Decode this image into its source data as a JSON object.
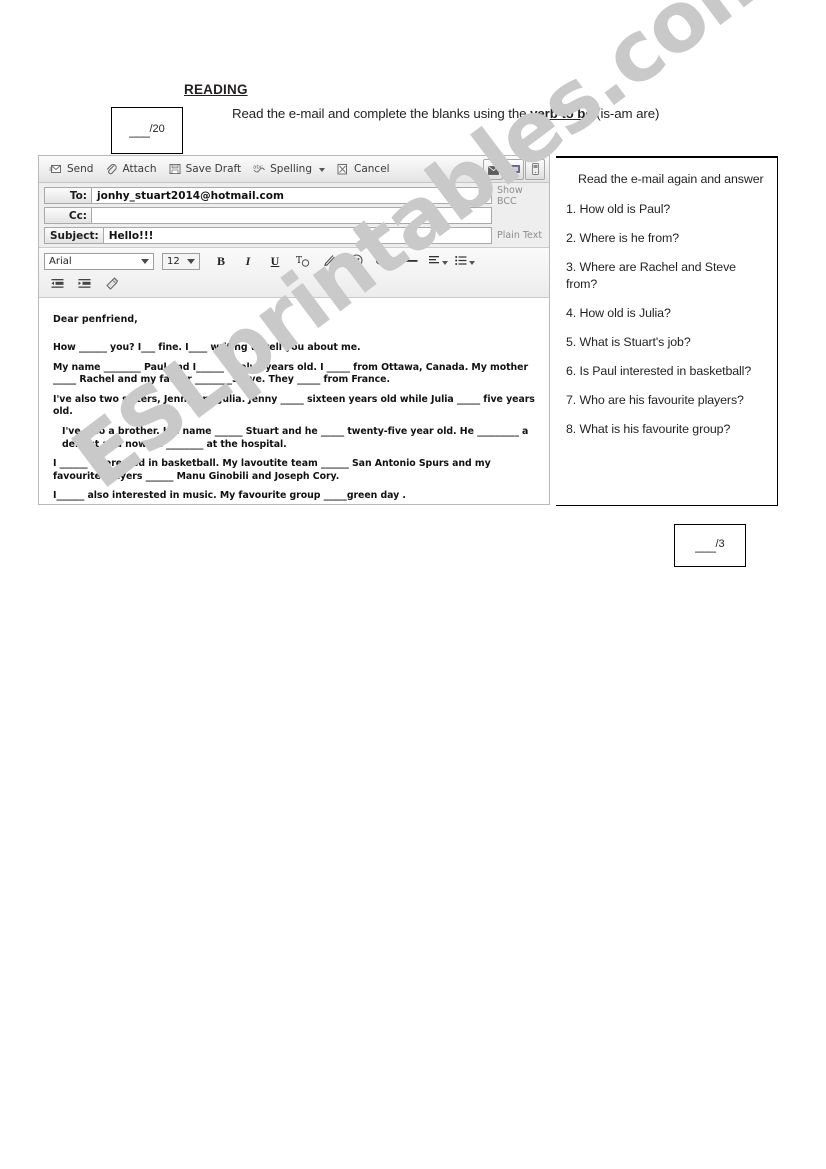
{
  "worksheet": {
    "section_title": "READING",
    "instruction_pre": "Read the e-mail and complete the blanks using the ",
    "instruction_bold": "verb to be",
    "instruction_post": " (is-am are)",
    "score_reading": "___/20",
    "score_reading_blank": "___",
    "score_reading_denom": "/20",
    "score_questions_blank": "___",
    "score_questions_denom": "/3",
    "watermark": "ESLprintables.com"
  },
  "mail": {
    "toolbar": {
      "send_label": "Send",
      "attach_label": "Attach",
      "save_draft_label": "Save Draft",
      "spelling_label": "Spelling",
      "cancel_label": "Cancel",
      "icons": {
        "send": "send-envelope-icon",
        "attach": "paperclip-icon",
        "save_draft": "floppy-disk-icon",
        "spelling": "abc-check-icon",
        "cancel": "cancel-icon",
        "right_1": "envelope-icon",
        "right_2": "message-screen-icon",
        "right_3": "mobile-phone-icon"
      }
    },
    "fields": {
      "to_label": "To:",
      "to_value": "jonhy_stuart2014@hotmail.com",
      "to_aside": "Show BCC",
      "cc_label": "Cc:",
      "cc_value": "",
      "cc_aside": "",
      "subject_label": "Subject:",
      "subject_value": "Hello!!!",
      "subject_aside": "Plain Text"
    },
    "format_bar": {
      "font_family_value": "Arial",
      "font_size_value": "12",
      "bold": "B",
      "italic": "I",
      "underline": "U",
      "text_color": "T",
      "highlight_icon": "highlighter-pen-icon",
      "emoticon_icon": "smiley-face-icon",
      "link_icon": "link-chain-icon",
      "horizontal_rule_icon": "horizontal-rule-icon",
      "align_icon": "align-text-icon",
      "list_icon": "bullet-list-icon",
      "indent_decrease_icon": "indent-decrease-icon",
      "indent_increase_icon": "indent-increase-icon",
      "clear_format_icon": "clear-formatting-icon"
    },
    "body": {
      "salutation": "Dear penfriend,",
      "paragraphs": [
        "How ______ you? I___ fine. I____ writing to tell you about me.",
        "My name ________ Paul and I______ twelve years old. I _____ from Ottawa, Canada.  My mother _____ Rachel and my father ________Steve.  They _____ from France.",
        "I've also two sisters, Jenny and Julia. Jenny _____ sixteen years old while Julia _____ five years old.",
        "I've also a brother. His name ______ Stuart and he _____ twenty-five year old. He _________ a dentist and now he ________ at the hospital.",
        "I ______ interested in basketball. My lavoutite team ______ San Antonio Spurs and my favourite players ______ Manu Ginobili and Joseph Cory.",
        "I______ also interested in music. My favourite group _____green  day ."
      ]
    }
  },
  "questions_panel": {
    "intro": "Read the e-mail again and answer",
    "items": [
      "1. How old is Paul?",
      "2. Where is he from?",
      "3. Where are Rachel and Steve from?",
      "4. How old is Julia?",
      "5. What is Stuart's job?",
      "6. Is Paul interested in basketball?",
      "7. Who are his favourite players?",
      "8.  What is his favourite group?"
    ]
  }
}
